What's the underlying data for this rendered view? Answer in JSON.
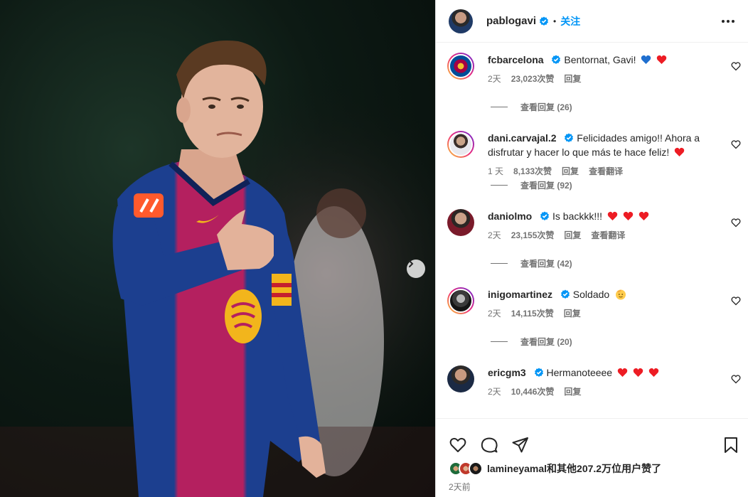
{
  "post": {
    "author": "pablogavi",
    "follow_label": "关注",
    "separator": "•",
    "liked_by": "lamineyamal和其他207.2万位用户赞了",
    "time": "2天前"
  },
  "colors": {
    "accent": "#0095f6",
    "verified": "#0095f6",
    "heart_red": "#ed1c24",
    "heart_blue": "#1f6fcf"
  },
  "comments": [
    {
      "user": "fcbarcelona",
      "text": "Bentornat, Gavi!",
      "emojis": [
        "blue-heart",
        "red-heart"
      ],
      "time": "2天",
      "likes": "23,023次赞",
      "reply": "回复",
      "translate": "",
      "view_replies": "查看回复 (26)"
    },
    {
      "user": "dani.carvajal.2",
      "text": "Felicidades amigo!! Ahora a disfrutar y hacer lo que más te hace feliz!",
      "emojis": [
        "red-heart"
      ],
      "time": "1 天",
      "likes": "8,133次赞",
      "reply": "回复",
      "translate": "查看翻译",
      "view_replies": "查看回复 (92)"
    },
    {
      "user": "daniolmo",
      "text": "Is backkk!!!",
      "emojis": [
        "red-heart",
        "red-heart",
        "red-heart"
      ],
      "time": "2天",
      "likes": "23,155次赞",
      "reply": "回复",
      "translate": "查看翻译",
      "view_replies": "查看回复 (42)"
    },
    {
      "user": "inigomartinez",
      "text": "Soldado",
      "emojis": [
        "saluting-face"
      ],
      "time": "2天",
      "likes": "14,115次赞",
      "reply": "回复",
      "translate": "",
      "view_replies": "查看回复 (20)"
    },
    {
      "user": "ericgm3",
      "text": "Hermanoteeee",
      "emojis": [
        "red-heart",
        "red-heart",
        "red-heart"
      ],
      "time": "2天",
      "likes": "10,446次赞",
      "reply": "回复",
      "translate": "",
      "view_replies": ""
    }
  ],
  "icons": {
    "more": "more-horizontal-icon",
    "like": "heart-outline-icon",
    "comment": "comment-bubble-icon",
    "share": "paper-plane-icon",
    "save": "bookmark-icon",
    "next": "chevron-right-icon"
  }
}
